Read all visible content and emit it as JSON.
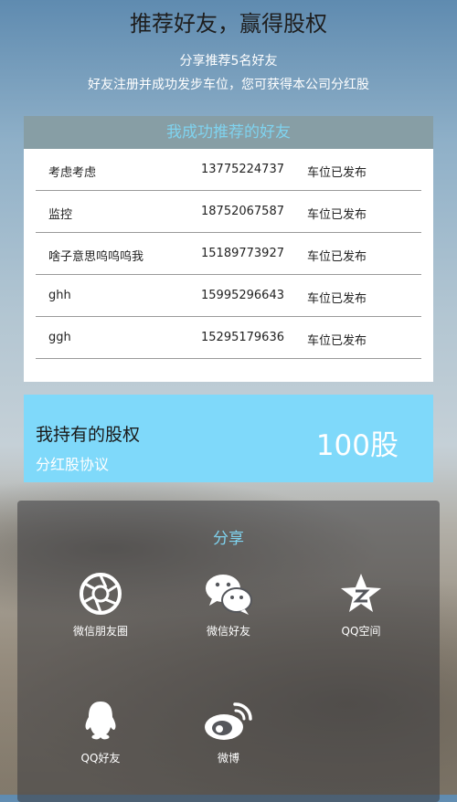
{
  "header": {
    "title": "推荐好友，赢得股权",
    "subtitle_line1": "分享推荐5名好友",
    "subtitle_line2": "好友注册并成功发步车位，您可获得本公司分红股"
  },
  "friends": {
    "heading": "我成功推荐的好友",
    "rows": [
      {
        "name": "考虑考虑",
        "phone": "13775224737",
        "status": "车位已发布"
      },
      {
        "name": "监控",
        "phone": "18752067587",
        "status": "车位已发布"
      },
      {
        "name": "啥子意思呜呜呜我",
        "phone": "15189773927",
        "status": "车位已发布"
      },
      {
        "name": "ghh",
        "phone": "15995296643",
        "status": "车位已发布"
      },
      {
        "name": "ggh",
        "phone": "15295179636",
        "status": "车位已发布"
      }
    ]
  },
  "equity": {
    "title": "我持有的股权",
    "agreement_link": "分红股协议",
    "value": "100股"
  },
  "share": {
    "title": "分享",
    "items": [
      {
        "label": "微信朋友圈",
        "icon": "moments-icon"
      },
      {
        "label": "微信好友",
        "icon": "wechat-icon"
      },
      {
        "label": "QQ空间",
        "icon": "qzone-icon"
      },
      {
        "label": "QQ好友",
        "icon": "qq-icon"
      },
      {
        "label": "微博",
        "icon": "weibo-icon"
      }
    ]
  },
  "colors": {
    "accent_blue": "#7fd9fa",
    "header_bar": "#879ea5",
    "heading_text": "#7fd3ef"
  }
}
